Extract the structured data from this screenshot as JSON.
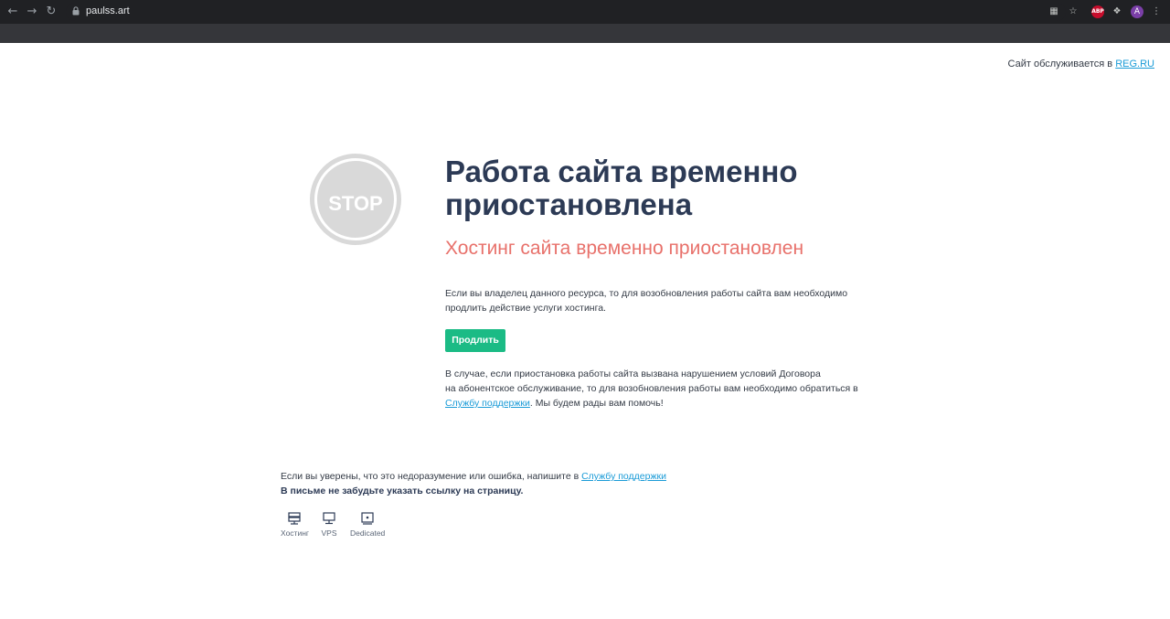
{
  "browser": {
    "back_icon": "arrow-left-icon",
    "forward_icon": "arrow-right-icon",
    "reload_icon": "reload-icon",
    "url": "paulss.art",
    "translate_icon": "translate-icon",
    "star_icon": "star-icon",
    "abp_label": "ABP",
    "extensions_icon": "puzzle-icon",
    "avatar_letter": "A",
    "menu_icon": "kebab-menu-icon"
  },
  "header": {
    "served_text": "Сайт обслуживается в ",
    "served_link": "REG.RU"
  },
  "stop_sign": {
    "label": "STOP"
  },
  "main": {
    "title": "Работа сайта временно приостановлена",
    "subtitle": "Хостинг сайта временно приостановлен",
    "paragraph1": "Если вы владелец данного ресурса, то для возобновления работы сайта вам необходимо продлить действие услуги хостинга.",
    "renew_button": "Продлить",
    "paragraph2_line1": "В случае, если приостановка работы сайта вызвана нарушением условий Договора",
    "paragraph2_line2": "на абонентское обслуживание, то для возобновления работы вам необходимо обратиться в",
    "paragraph2_link": "Службу поддержки",
    "paragraph2_tail": ". Мы будем рады вам помочь!"
  },
  "footer": {
    "note_text": "Если вы уверены, что это недоразумение или ошибка, напишите в ",
    "note_link": "Службу поддержки",
    "note_bold": "В письме не забудьте указать ссылку на страницу.",
    "services": [
      {
        "label": "Хостинг",
        "icon": "hosting-icon"
      },
      {
        "label": "VPS",
        "icon": "vps-icon"
      },
      {
        "label": "Dedicated",
        "icon": "dedicated-icon"
      }
    ]
  },
  "colors": {
    "title": "#2c3a55",
    "subtitle": "#e8716b",
    "button": "#1bbb85",
    "link": "#1a9bd7"
  }
}
